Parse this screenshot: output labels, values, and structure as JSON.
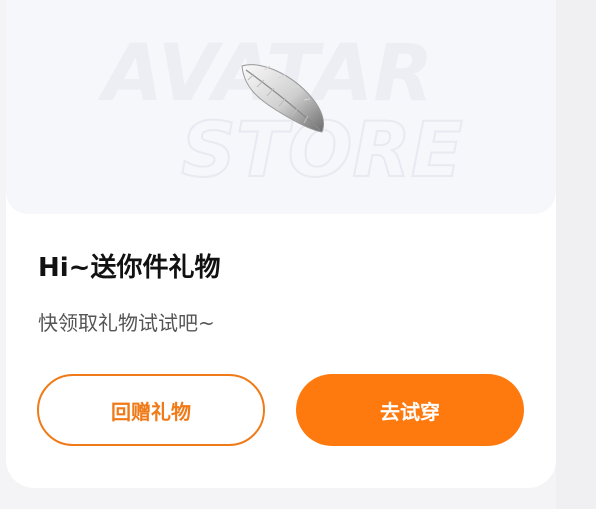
{
  "hero": {
    "watermark_line1": "AVATAR",
    "watermark_line2": "STORE",
    "item_icon": "feather-icon"
  },
  "card": {
    "title": "Hi~送你件礼物",
    "subtitle": "快领取礼物试试吧~"
  },
  "actions": {
    "return_gift_label": "回赠礼物",
    "try_on_label": "去试穿"
  },
  "colors": {
    "accent": "#ff7a0e",
    "accent_outline": "#f07a18",
    "hero_bg": "#f6f7fb",
    "title": "#111111",
    "subtitle": "#555555"
  }
}
